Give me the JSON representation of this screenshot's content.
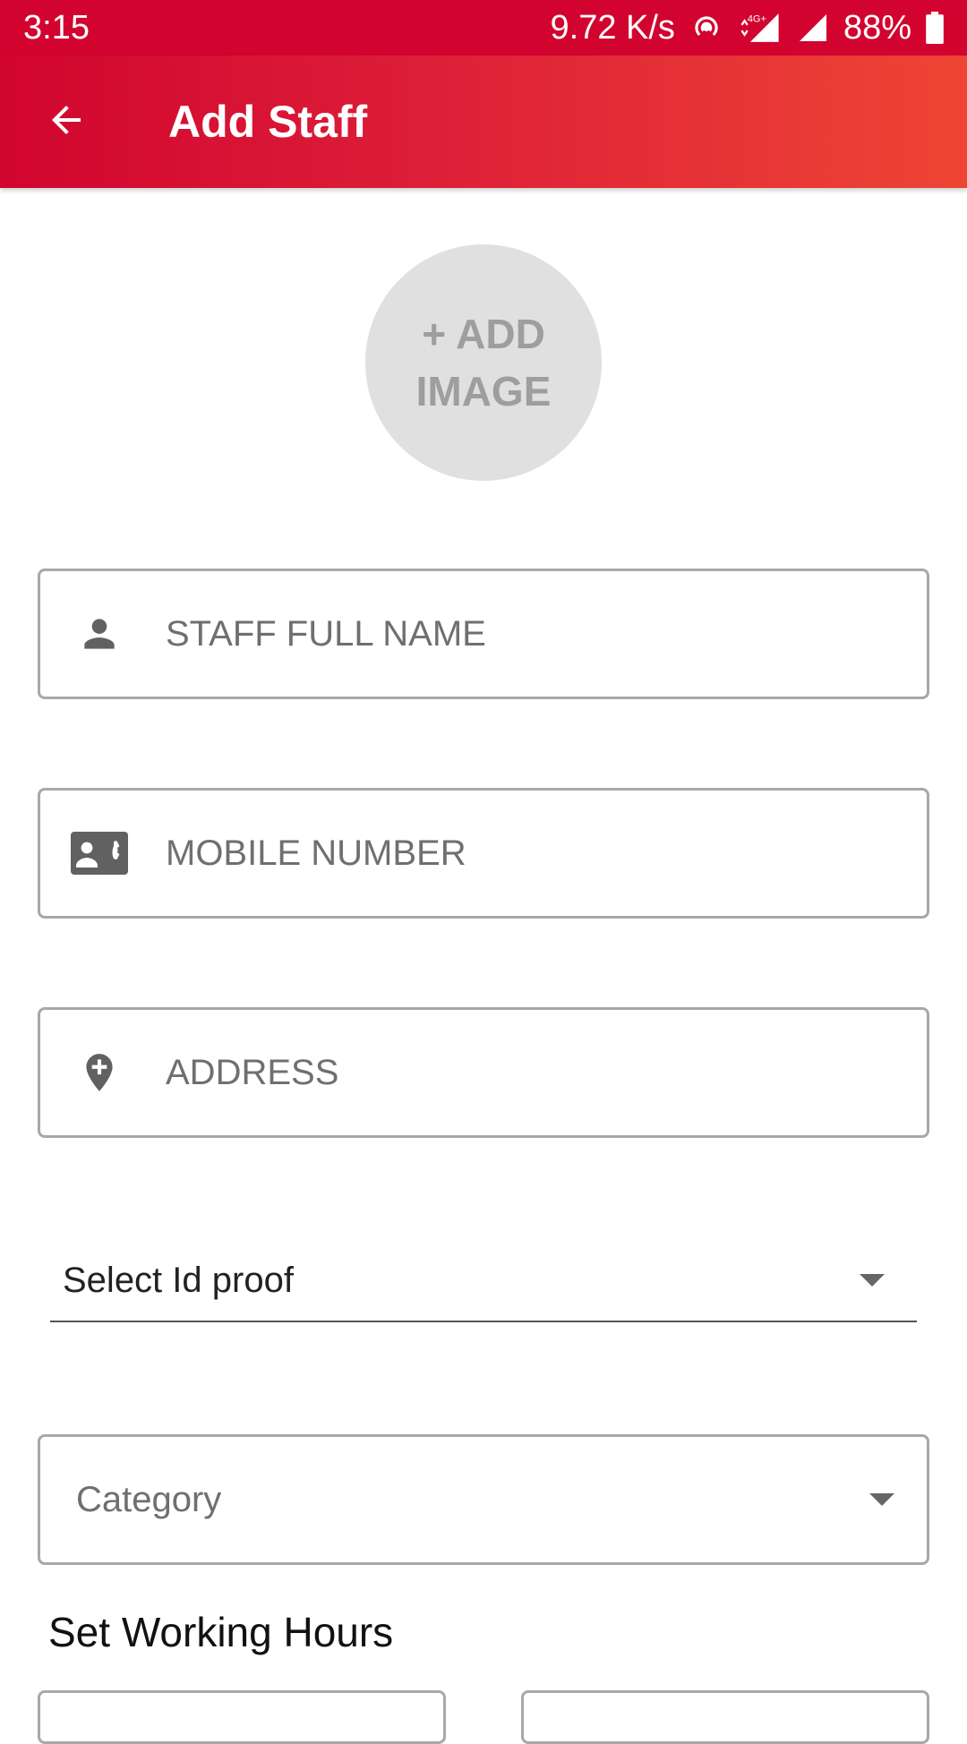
{
  "status_bar": {
    "time": "3:15",
    "network_speed": "9.72 K/s",
    "battery": "88%",
    "icons": [
      "hotspot-icon",
      "4g-signal-icon",
      "signal-icon",
      "battery-icon"
    ]
  },
  "app_bar": {
    "title": "Add Staff",
    "back_icon": "arrow-back-icon"
  },
  "avatar": {
    "label_line1": "+ ADD",
    "label_line2": "IMAGE"
  },
  "form": {
    "name_placeholder": "STAFF FULL NAME",
    "mobile_placeholder": "MOBILE NUMBER",
    "address_placeholder": "ADDRESS",
    "id_proof_label": "Select Id proof",
    "category_label": "Category"
  },
  "working_hours": {
    "title": "Set Working Hours"
  },
  "colors": {
    "primary": "#d2042f",
    "gradient_end": "#ee4534",
    "avatar_bg": "#e0e0e0"
  }
}
